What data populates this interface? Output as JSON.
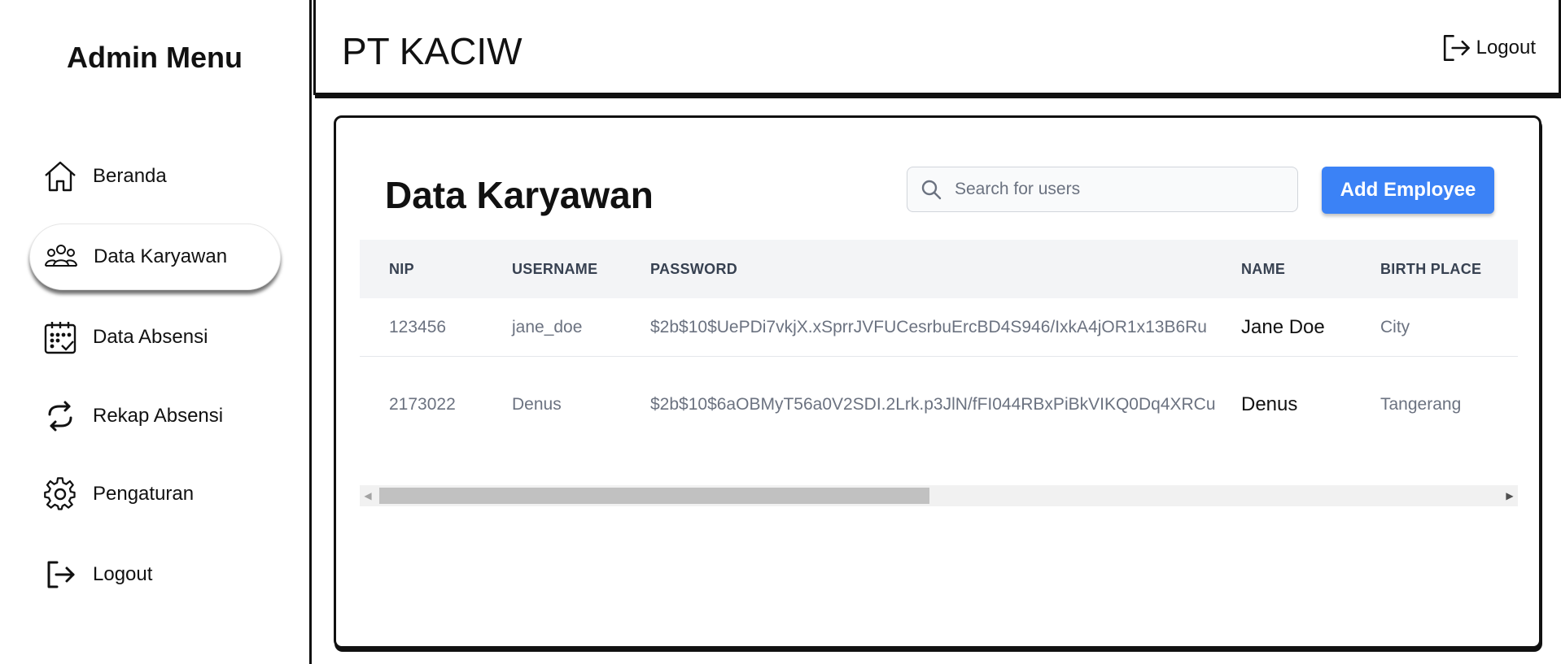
{
  "sidebar": {
    "title": "Admin Menu",
    "items": [
      {
        "label": "Beranda",
        "icon": "home-icon",
        "active": false
      },
      {
        "label": "Data Karyawan",
        "icon": "users-icon",
        "active": true
      },
      {
        "label": "Data Absensi",
        "icon": "calendar-check-icon",
        "active": false
      },
      {
        "label": "Rekap Absensi",
        "icon": "refresh-icon",
        "active": false
      },
      {
        "label": "Pengaturan",
        "icon": "gear-icon",
        "active": false
      },
      {
        "label": "Logout",
        "icon": "logout-icon",
        "active": false
      }
    ]
  },
  "header": {
    "brand": "PT KACIW",
    "logout_label": "Logout"
  },
  "main": {
    "title": "Data Karyawan",
    "search": {
      "placeholder": "Search for users",
      "value": ""
    },
    "add_button_label": "Add Employee",
    "table": {
      "columns": [
        "NIP",
        "USERNAME",
        "PASSWORD",
        "NAME",
        "BIRTH PLACE"
      ],
      "rows": [
        [
          "123456",
          "jane_doe",
          "$2b$10$UePDi7vkjX.xSprrJVFUCesrbuErcBD4S946/IxkA4jOR1x13B6Ru",
          "Jane Doe",
          "City"
        ],
        [
          "2173022",
          "Denus",
          "$2b$10$6aOBMyT56a0V2SDI.2Lrk.p3JlN/fFI044RBxPiBkVIKQ0Dq4XRCu",
          "Denus",
          "Tangerang"
        ]
      ]
    }
  },
  "colors": {
    "accent": "#3b82f6",
    "table_header_bg": "#f3f4f6",
    "border": "#111111"
  }
}
